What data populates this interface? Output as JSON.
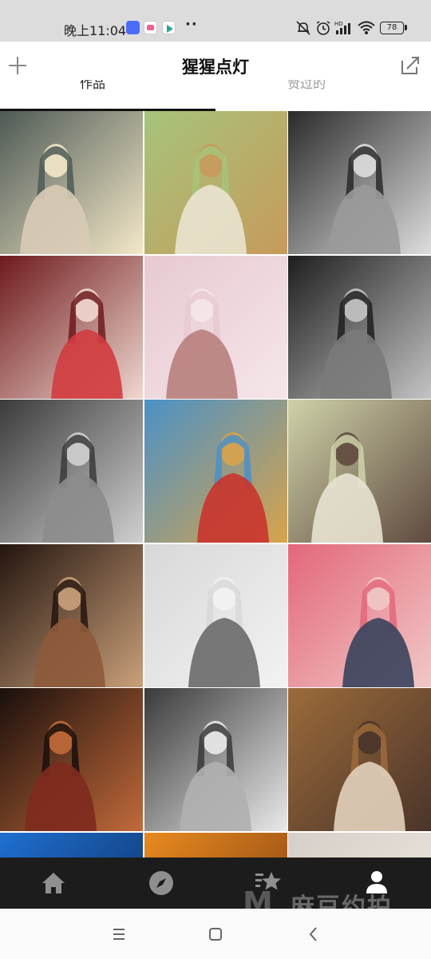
{
  "status_bar": {
    "time": "晚上11:04",
    "dots": "··",
    "battery": "78",
    "app_icons": [
      {
        "name": "message-app-icon",
        "color": "#4a6cf7"
      },
      {
        "name": "shopping-app-icon",
        "color": "#f06292"
      },
      {
        "name": "video-app-icon",
        "color": "#26a69a"
      }
    ]
  },
  "header": {
    "title": "猩猩点灯",
    "add_icon": "plus-icon",
    "share_icon": "share-icon"
  },
  "tabs": [
    {
      "label": "作品",
      "active": true
    },
    {
      "label": "赞过的",
      "active": false
    }
  ],
  "grid": {
    "photos": [
      {
        "name": "photo-woman-holding-lantern",
        "palette": [
          "#4e5a55",
          "#d9cbb6",
          "#f4e8c8"
        ]
      },
      {
        "name": "photo-woman-with-straw-hat-in-field",
        "palette": [
          "#a6c47a",
          "#e9e4d0",
          "#c79a5c"
        ]
      },
      {
        "name": "photo-woman-with-headdress-bw",
        "palette": [
          "#2a2a2a",
          "#9a9a9a",
          "#dedede"
        ]
      },
      {
        "name": "photo-woman-with-mask",
        "palette": [
          "#6e1a1c",
          "#d23b3f",
          "#f0d7cf"
        ]
      },
      {
        "name": "photo-woman-with-umbrella-blossoms",
        "palette": [
          "#e7c9d1",
          "#b77f7c",
          "#f5e6e9"
        ]
      },
      {
        "name": "photo-elderly-woman-portrait-bw",
        "palette": [
          "#1e1e1e",
          "#7a7a7a",
          "#c4c4c4"
        ]
      },
      {
        "name": "photo-woman-back-bw",
        "palette": [
          "#3b3b3b",
          "#8c8c8c",
          "#d0d0d0"
        ]
      },
      {
        "name": "photo-woman-red-dress-sky",
        "palette": [
          "#4b91c7",
          "#c9342c",
          "#d8a34b"
        ]
      },
      {
        "name": "photo-woman-in-meadow",
        "palette": [
          "#cfd2a9",
          "#e8e2d2",
          "#5f4a3f"
        ]
      },
      {
        "name": "photo-woman-dark-doorway",
        "palette": [
          "#24150f",
          "#8d5a3a",
          "#caa07a"
        ]
      },
      {
        "name": "photo-woman-looking-up-bw",
        "palette": [
          "#d8d8d8",
          "#6a6a6a",
          "#f2f2f2"
        ]
      },
      {
        "name": "photo-woman-with-pink-umbrella",
        "palette": [
          "#e3677a",
          "#38425c",
          "#f1c8c7"
        ]
      },
      {
        "name": "photo-woman-dark-red-light",
        "palette": [
          "#1a0f0c",
          "#7e2a1e",
          "#c26a3a"
        ]
      },
      {
        "name": "photo-elderly-man-bw",
        "palette": [
          "#3a3a3a",
          "#b0b0b0",
          "#eaeaea"
        ]
      },
      {
        "name": "photo-woman-in-corridor",
        "palette": [
          "#9c6b3a",
          "#e2d2bd",
          "#4a342a"
        ]
      },
      {
        "name": "photo-blue-lights",
        "palette": [
          "#1f6fd1",
          "#8fc6ff",
          "#0d2b5a"
        ]
      },
      {
        "name": "photo-warm-hands",
        "palette": [
          "#e88a1f",
          "#f6c56b",
          "#7a3a12"
        ]
      },
      {
        "name": "photo-face-closeup",
        "palette": [
          "#d6cfc8",
          "#6b5a52",
          "#f0e9e2"
        ]
      }
    ]
  },
  "bottom_nav": {
    "items": [
      {
        "name": "home-icon",
        "active": false
      },
      {
        "name": "compass-icon",
        "active": false
      },
      {
        "name": "star-feed-icon",
        "active": false
      },
      {
        "name": "profile-icon",
        "active": true
      }
    ],
    "watermark": "麻豆约拍",
    "watermark_logo": "M"
  },
  "system_nav": {
    "items": [
      "menu-icon",
      "home-square-icon",
      "back-icon"
    ]
  }
}
